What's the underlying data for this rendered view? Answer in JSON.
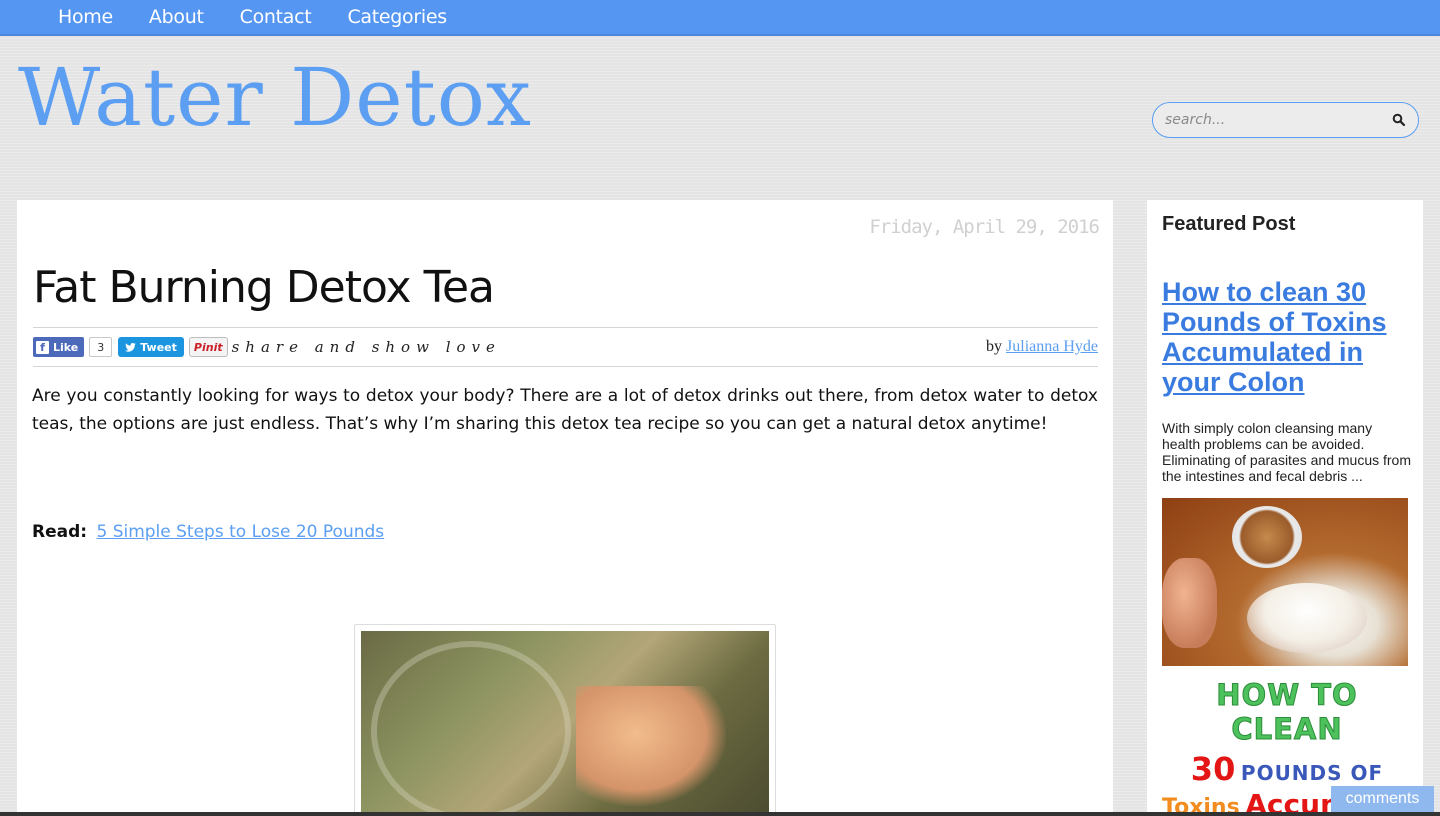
{
  "nav": {
    "items": [
      "Home",
      "About",
      "Contact",
      "Categories"
    ]
  },
  "site": {
    "title": "Water Detox"
  },
  "search": {
    "placeholder": "search..."
  },
  "post": {
    "date": "Friday, April 29, 2016",
    "title": "Fat Burning Detox Tea",
    "share": {
      "like_label": "Like",
      "like_count": "3",
      "tweet_label": "Tweet",
      "pin_label": "Pinit",
      "tagline": "share and show love"
    },
    "byline_prefix": "by",
    "author": "Julianna Hyde",
    "intro": "Are you constantly looking for ways to detox your body? There are a lot of detox drinks out there, from detox water to detox teas, the options are just endless. That’s why I’m sharing this detox tea recipe so you can get a natural detox anytime!",
    "read_label": "Read:",
    "read_link": "5 Simple Steps to Lose 20 Pounds"
  },
  "sidebar": {
    "heading": "Featured Post",
    "featured_title": "How to clean 30 Pounds of Toxins Accumulated in your Colon",
    "excerpt": "With simply colon cleansing many health problems can be avoided. Eliminating of parasites and mucus from the intestines and fecal debris ...",
    "promo": {
      "line1": "HOW TO CLEAN",
      "number": "30",
      "pounds": "POUNDS OF",
      "toxins": "Toxins",
      "accumulated": "Accumulated"
    }
  },
  "comments_tab": "comments",
  "colors": {
    "accent": "#5596f2",
    "link": "#3a7be0",
    "background": "#e4e4e4"
  }
}
